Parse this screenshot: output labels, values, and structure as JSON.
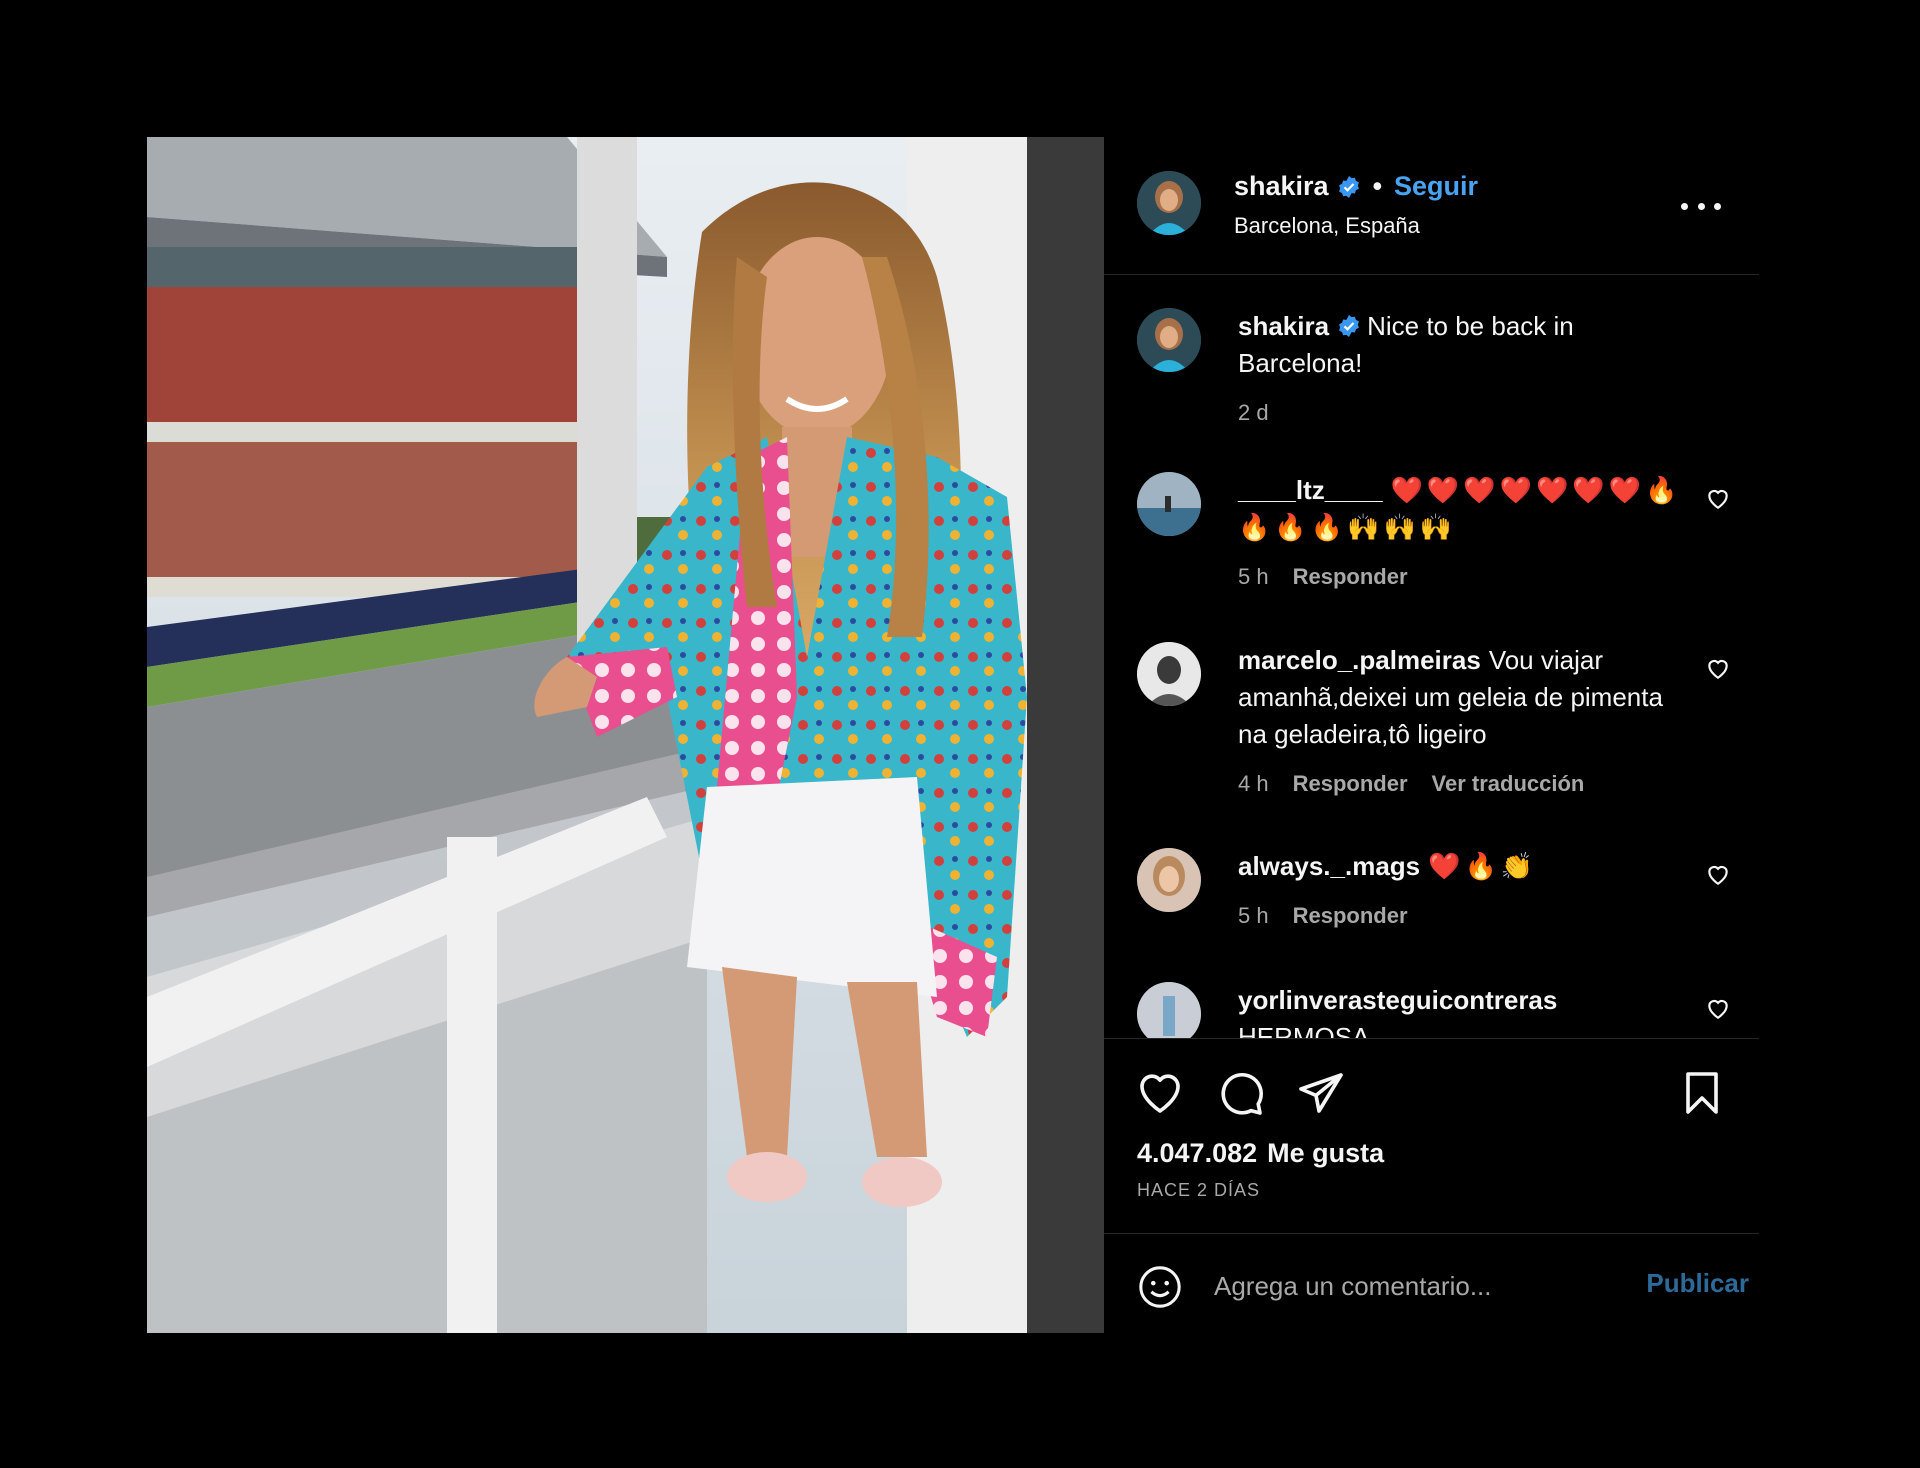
{
  "post": {
    "username": "shakira",
    "dot": "•",
    "follow_label": "Seguir",
    "location": "Barcelona, España"
  },
  "caption": {
    "username": "shakira",
    "text": "Nice to be back in Barcelona!",
    "time": "2 d"
  },
  "comments": [
    {
      "username": "____ltz____",
      "text": "❤️❤️❤️❤️❤️❤️❤️🔥🔥🔥🔥🙌🙌🙌",
      "time": "5 h",
      "reply": "Responder"
    },
    {
      "username": "marcelo_.palmeiras",
      "text": "Vou viajar amanhã,deixei um geleia de pimenta na geladeira,tô ligeiro",
      "time": "4 h",
      "reply": "Responder",
      "translate": "Ver traducción"
    },
    {
      "username": "always._.mags",
      "text": "❤️🔥👏",
      "time": "5 h",
      "reply": "Responder"
    },
    {
      "username": "yorlinverasteguicontreras",
      "text": "HERMOSA"
    }
  ],
  "likes": {
    "count": "4.047.082",
    "label": "Me gusta"
  },
  "posted_ago": "HACE 2 DÍAS",
  "add_comment": {
    "placeholder": "Agrega un comentario...",
    "publish_label": "Publicar"
  },
  "icons": {
    "like": "heart-icon",
    "comment": "comment-icon",
    "share": "send-icon",
    "save": "bookmark-icon",
    "emoji": "smile-icon",
    "more": "more-icon",
    "verified": "verified-badge-icon"
  },
  "colors": {
    "background": "#000000",
    "link_blue": "#4aa3f0",
    "verified_blue": "#3897f0",
    "muted_text": "#a8a8a8",
    "publish_disabled": "#2c6a99",
    "heart_red": "#e0261f"
  }
}
